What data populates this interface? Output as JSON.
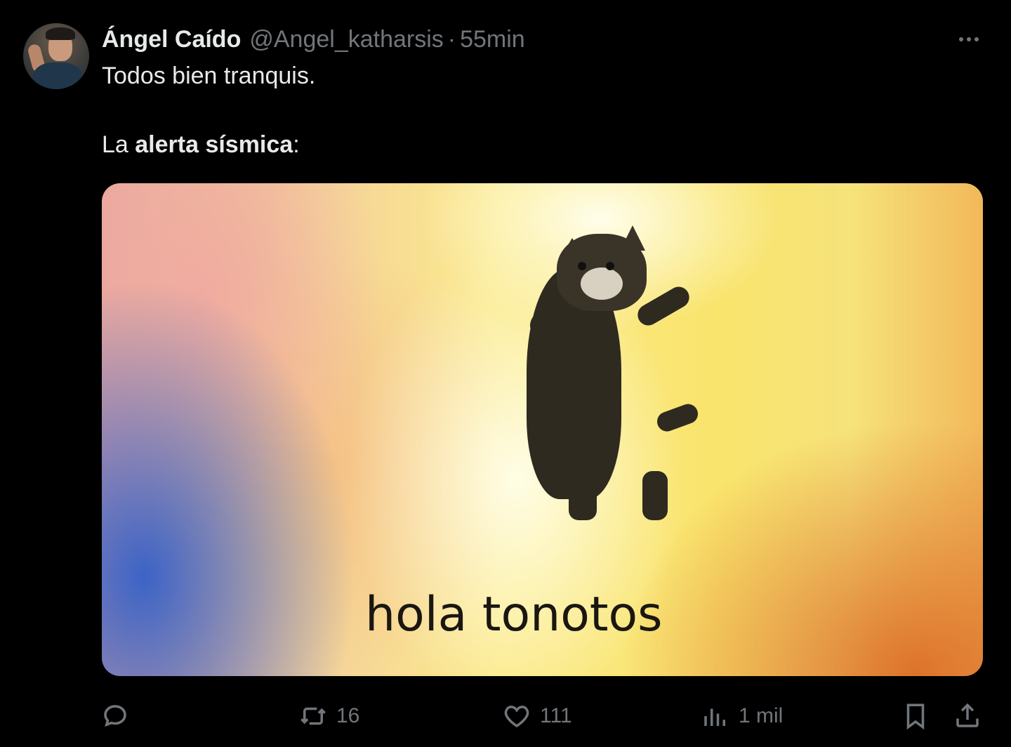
{
  "tweet": {
    "author_name": "Ángel Caído",
    "author_handle": "@Angel_katharsis",
    "separator": "·",
    "time": "55min",
    "text_line1": "Todos bien tranquis.",
    "text_line2_prefix": "La ",
    "text_line2_bold": "alerta sísmica",
    "text_line2_suffix": ":",
    "media_caption": "hola tonotos"
  },
  "actions": {
    "reply_icon": "reply-icon",
    "retweet_icon": "retweet-icon",
    "retweet_count": "16",
    "like_icon": "heart-icon",
    "like_count": "111",
    "views_icon": "views-icon",
    "views_count": "1 mil",
    "bookmark_icon": "bookmark-icon",
    "share_icon": "share-icon"
  },
  "colors": {
    "background": "#000000",
    "primary_text": "#e7e9ea",
    "secondary_text": "#71767b"
  }
}
